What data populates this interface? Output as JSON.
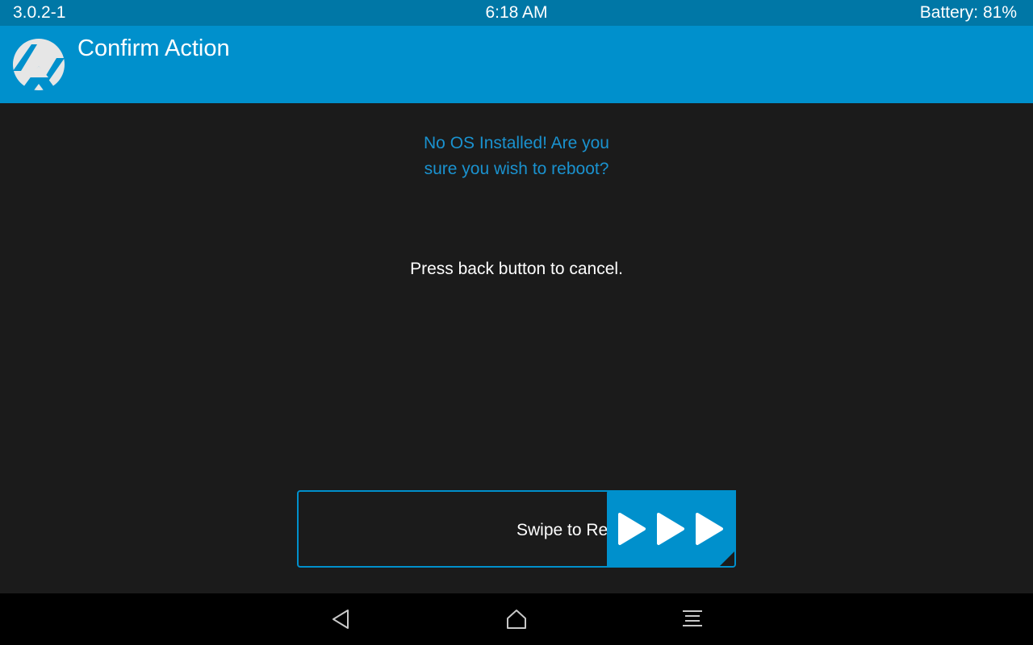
{
  "status_bar": {
    "version": "3.0.2-1",
    "time": "6:18 AM",
    "battery": "Battery: 81%"
  },
  "header": {
    "title": "Confirm Action",
    "logo_icon": "twrp-logo-icon"
  },
  "dialog": {
    "question_line1": "No OS Installed! Are you",
    "question_line2": "sure you wish to reboot?",
    "cancel_hint": "Press back button to cancel."
  },
  "swipe": {
    "label": "Swipe to Reboot",
    "handle_icon": "triple-play-arrow-icon"
  },
  "nav_bar": {
    "back_icon": "back-triangle-icon",
    "home_icon": "home-icon",
    "menu_icon": "menu-lines-icon"
  },
  "colors": {
    "status_bar": "#0077a6",
    "header": "#0090cc",
    "background": "#1b1b1b",
    "accent_text": "#1a92cf",
    "nav_bar": "#000000"
  }
}
